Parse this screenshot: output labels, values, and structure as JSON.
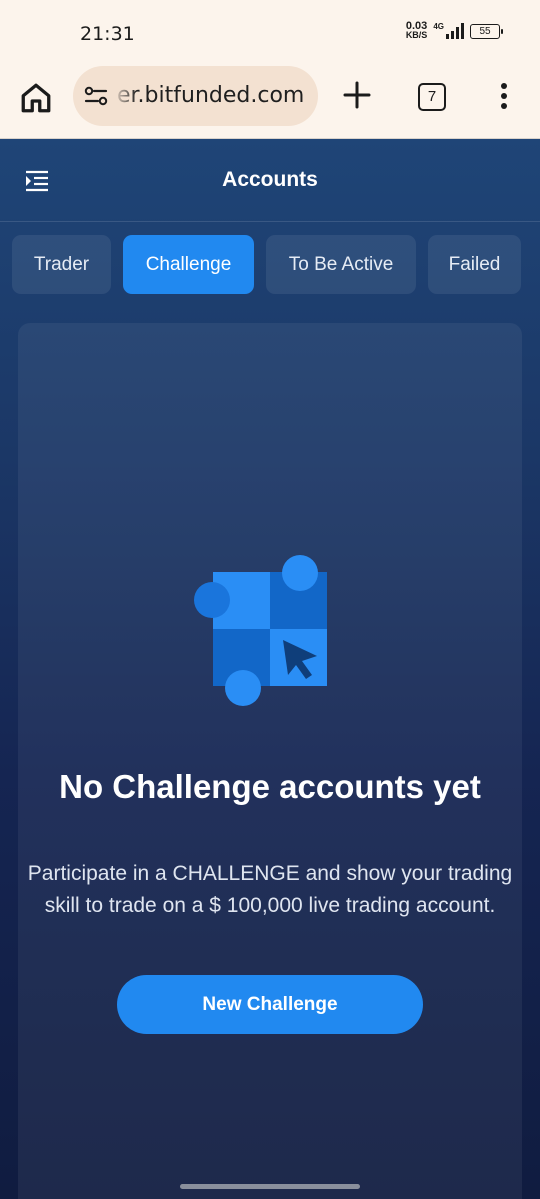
{
  "status_bar": {
    "time": "21:31",
    "net_speed_value": "0.03",
    "net_speed_unit": "KB/S",
    "network_type": "4G",
    "battery": "55"
  },
  "browser": {
    "url": "er.bitfunded.com",
    "tab_count": "7",
    "icons": [
      "home-icon",
      "site-settings-icon",
      "plus-icon",
      "tab-switcher-icon",
      "kebab-menu-icon"
    ]
  },
  "app": {
    "title": "Accounts",
    "tabs": [
      {
        "label": "Trader",
        "active": false
      },
      {
        "label": "Challenge",
        "active": true
      },
      {
        "label": "To Be Active",
        "active": false
      },
      {
        "label": "Failed",
        "active": false
      }
    ],
    "empty_state": {
      "title": "No Challenge accounts yet",
      "description": "Participate in a CHALLENGE and show your trading skill to trade on a $ 100,000 live trading account.",
      "button_label": "New Challenge"
    }
  },
  "colors": {
    "accent": "#2189f0",
    "browser_bg": "#fcf4ec",
    "url_pill": "#f3e1d1"
  }
}
